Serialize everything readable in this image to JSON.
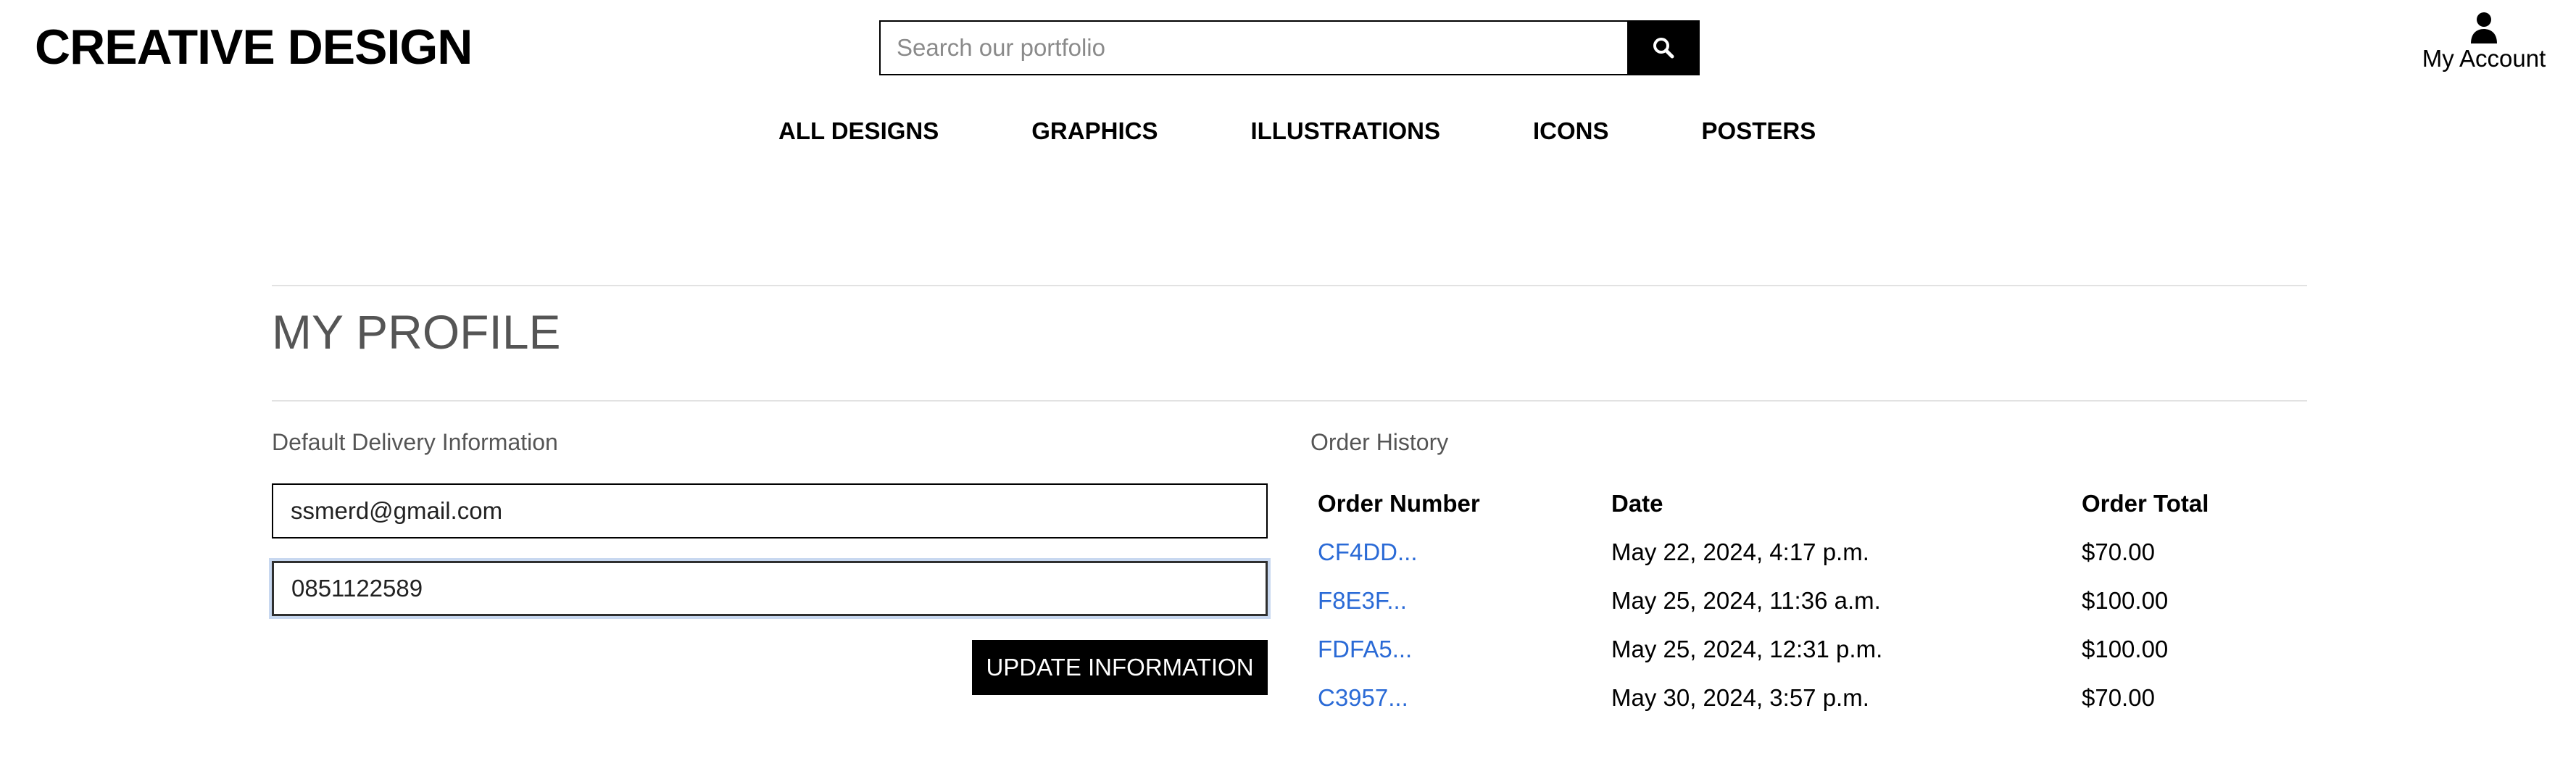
{
  "header": {
    "brand": "CREATIVE DESIGN",
    "search": {
      "placeholder": "Search our portfolio",
      "value": "",
      "icon": "search-icon"
    },
    "account": {
      "label": "My Account",
      "icon": "user-icon"
    }
  },
  "nav": {
    "items": [
      "ALL DESIGNS",
      "GRAPHICS",
      "ILLUSTRATIONS",
      "ICONS",
      "POSTERS"
    ]
  },
  "profile": {
    "title": "MY PROFILE",
    "delivery": {
      "heading": "Default Delivery Information",
      "email": "ssmerd@gmail.com",
      "phone": "0851122589",
      "button": "UPDATE INFORMATION"
    },
    "orders": {
      "heading": "Order History",
      "columns": [
        "Order Number",
        "Date",
        "Order Total"
      ],
      "rows": [
        {
          "number": "CF4DD...",
          "date": "May 22, 2024, 4:17 p.m.",
          "total": "$70.00"
        },
        {
          "number": "F8E3F...",
          "date": "May 25, 2024, 11:36 a.m.",
          "total": "$100.00"
        },
        {
          "number": "FDFA5...",
          "date": "May 25, 2024, 12:31 p.m.",
          "total": "$100.00"
        },
        {
          "number": "C3957...",
          "date": "May 30, 2024, 3:57 p.m.",
          "total": "$70.00"
        }
      ]
    }
  },
  "colors": {
    "text": "#000000",
    "muted": "#555555",
    "link": "#2a6ad6",
    "rule": "#e2e2e2",
    "focus_ring": "#c8d8f0"
  }
}
